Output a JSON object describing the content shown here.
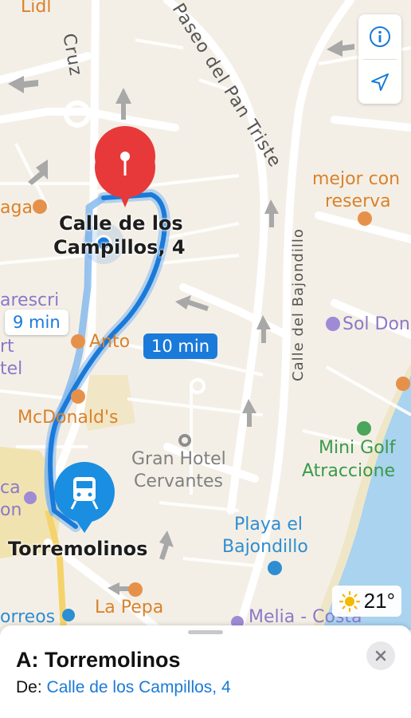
{
  "map": {
    "streets": {
      "cruz": "Cruz",
      "paseo": "Paseo del Pan Triste",
      "bajondillo": "Calle del Bajondillo"
    },
    "partial_labels": {
      "lidl": "Lidl",
      "aga": "aga",
      "arescri": "arescri",
      "rt": "rt",
      "tel": "tel",
      "ca": "ca",
      "on": "on",
      "orreos": "orreos",
      "anto": "Anto"
    },
    "pois": {
      "mejor_con_reserva_1": "mejor con",
      "mejor_con_reserva_2": "reserva",
      "sol_don": "Sol Don",
      "mcdonalds": "McDonald's",
      "gran_hotel_1": "Gran Hotel",
      "gran_hotel_2": "Cervantes",
      "mini_golf_1": "Mini Golf",
      "mini_golf_2": "Atraccione",
      "playa_1": "Playa el",
      "playa_2": "Bajondillo",
      "la_pepa": "La Pepa",
      "melia": "Melia - Costa"
    },
    "destination_pin_label_1": "Calle de los",
    "destination_pin_label_2": "Campillos, 4",
    "station_label": "Torremolinos",
    "route_times": {
      "alternate": "9 min",
      "main": "10 min"
    },
    "colors": {
      "route": "#1a7ad9",
      "pin": "#e8393a",
      "water": "#a9d3ef",
      "land": "#f4efe6"
    }
  },
  "controls": {
    "info_icon": "info-icon",
    "location_icon": "location-arrow-icon"
  },
  "weather": {
    "temperature": "21°",
    "icon": "sun-icon"
  },
  "sheet": {
    "title": "A: Torremolinos",
    "from_prefix": "De:",
    "from_value": "Calle de los Campillos, 4"
  }
}
